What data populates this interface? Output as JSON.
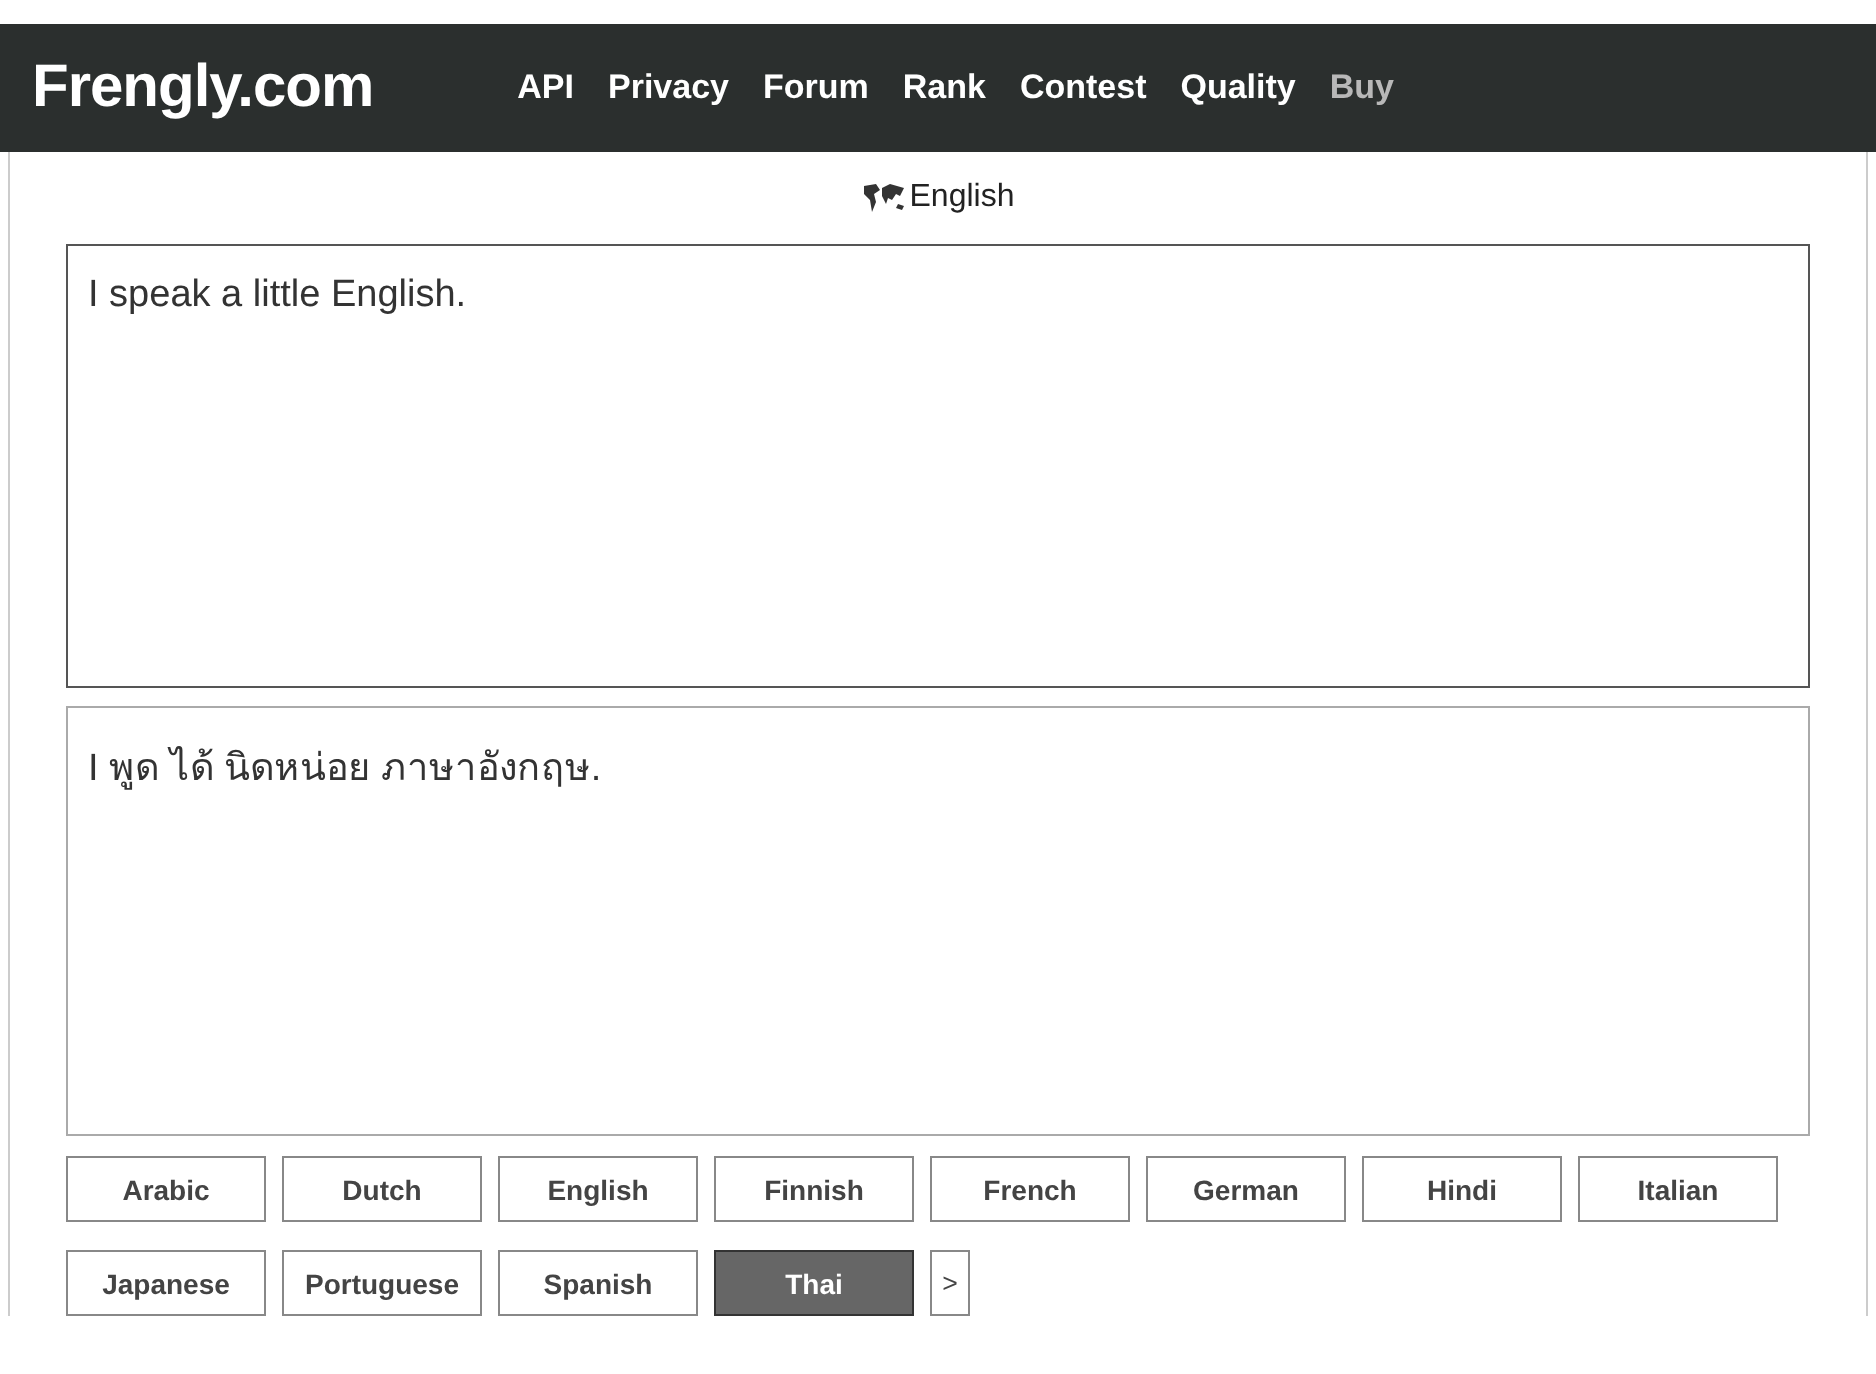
{
  "header": {
    "logo": "Frengly.com",
    "nav": [
      {
        "label": "API",
        "muted": false
      },
      {
        "label": "Privacy",
        "muted": false
      },
      {
        "label": "Forum",
        "muted": false
      },
      {
        "label": "Rank",
        "muted": false
      },
      {
        "label": "Contest",
        "muted": false
      },
      {
        "label": "Quality",
        "muted": false
      },
      {
        "label": "Buy",
        "muted": true
      }
    ]
  },
  "source_language": "English",
  "source_text": "I speak a little English.",
  "translation": "I พูด ได้ นิดหน่อย ภาษาอังกฤษ.",
  "languages": [
    {
      "label": "Arabic",
      "selected": false
    },
    {
      "label": "Dutch",
      "selected": false
    },
    {
      "label": "English",
      "selected": false
    },
    {
      "label": "Finnish",
      "selected": false
    },
    {
      "label": "French",
      "selected": false
    },
    {
      "label": "German",
      "selected": false
    },
    {
      "label": "Hindi",
      "selected": false
    },
    {
      "label": "Italian",
      "selected": false
    },
    {
      "label": "Japanese",
      "selected": false
    },
    {
      "label": "Portuguese",
      "selected": false
    },
    {
      "label": "Spanish",
      "selected": false
    },
    {
      "label": "Thai",
      "selected": true
    }
  ],
  "more_button": ">"
}
